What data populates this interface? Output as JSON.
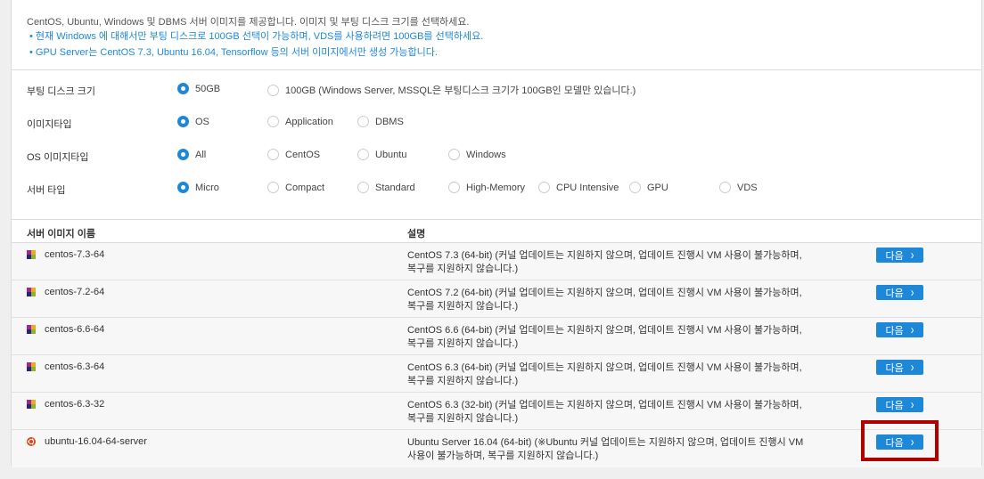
{
  "info": {
    "line0": "CentOS, Ubuntu, Windows 및 DBMS 서버 이미지를 제공합니다. 이미지 및 부팅 디스크 크기를 선택하세요.",
    "line1": "• 현재 Windows 에 대해서만 부팅 디스크로 100GB 선택이 가능하며, VDS를 사용하려면 100GB를 선택하세요.",
    "line2": "• GPU Server는 CentOS 7.3, Ubuntu 16.04, Tensorflow 등의 서버 이미지에서만 생성 가능합니다."
  },
  "options": {
    "boot_disk": {
      "label": "부팅 디스크 크기",
      "choices": [
        "50GB",
        "100GB (Windows Server, MSSQL은 부팅디스크 크기가 100GB인 모델만 있습니다.)"
      ],
      "selected": "50GB"
    },
    "image_type": {
      "label": "이미지타입",
      "choices": [
        "OS",
        "Application",
        "DBMS"
      ],
      "selected": "OS"
    },
    "os_image_type": {
      "label": "OS 이미지타입",
      "choices": [
        "All",
        "CentOS",
        "Ubuntu",
        "Windows"
      ],
      "selected": "All"
    },
    "server_type": {
      "label": "서버 타입",
      "choices": [
        "Micro",
        "Compact",
        "Standard",
        "High-Memory",
        "CPU Intensive",
        "GPU",
        "VDS"
      ],
      "selected": "Micro"
    }
  },
  "table": {
    "headers": {
      "name": "서버 이미지 이름",
      "desc": "설명"
    },
    "button_label": "다음",
    "rows": [
      {
        "icon": "centos-icon",
        "name": "centos-7.3-64",
        "desc1": "CentOS 7.3 (64-bit) (커널 업데이트는 지원하지 않으며, 업데이트 진행시 VM 사용이 불가능하며,",
        "desc2": "복구를 지원하지 않습니다.)"
      },
      {
        "icon": "centos-icon",
        "name": "centos-7.2-64",
        "desc1": "CentOS 7.2 (64-bit) (커널 업데이트는 지원하지 않으며, 업데이트 진행시 VM 사용이 불가능하며,",
        "desc2": "복구를 지원하지 않습니다.)"
      },
      {
        "icon": "centos-icon",
        "name": "centos-6.6-64",
        "desc1": "CentOS 6.6 (64-bit) (커널 업데이트는 지원하지 않으며, 업데이트 진행시 VM 사용이 불가능하며,",
        "desc2": "복구를 지원하지 않습니다.)"
      },
      {
        "icon": "centos-icon",
        "name": "centos-6.3-64",
        "desc1": "CentOS 6.3 (64-bit) (커널 업데이트는 지원하지 않으며, 업데이트 진행시 VM 사용이 불가능하며,",
        "desc2": "복구를 지원하지 않습니다.)"
      },
      {
        "icon": "centos-icon",
        "name": "centos-6.3-32",
        "desc1": "CentOS 6.3 (32-bit) (커널 업데이트는 지원하지 않으며, 업데이트 진행시 VM 사용이 불가능하며,",
        "desc2": "복구를 지원하지 않습니다.)"
      },
      {
        "icon": "ubuntu-icon",
        "name": "ubuntu-16.04-64-server",
        "desc1": "Ubuntu Server 16.04 (64-bit) (※Ubuntu 커널 업데이트는 지원하지 않으며, 업데이트 진행시 VM",
        "desc2": "사용이 불가능하며, 복구를 지원하지 않습니다.)"
      }
    ]
  },
  "colors": {
    "accent": "#1e88d8",
    "highlight": "#b00000"
  }
}
